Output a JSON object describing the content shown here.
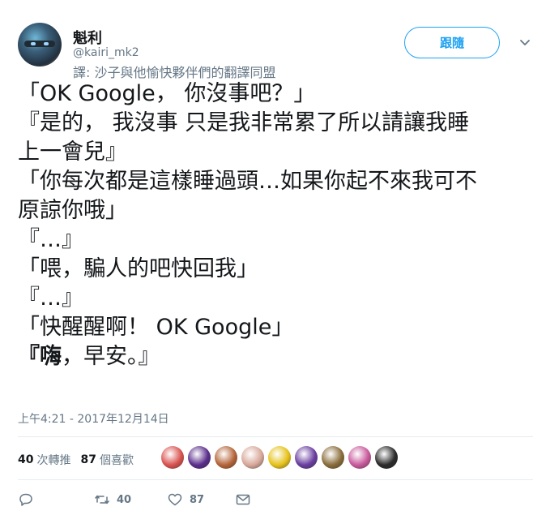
{
  "user": {
    "name": "魁利",
    "handle": "@kairi_mk2",
    "translation_note": "譯: 沙子與他愉快夥伴們的翻譯同盟"
  },
  "follow_button": {
    "label": "跟隨"
  },
  "tweet": {
    "lines": [
      "「OK Google， 你沒事吧？」",
      "『是的， 我沒事 只是我非常累了所以請讓我睡",
      "上一會兒』",
      "「你每次都是這樣睡過頭…如果你起不來我可不",
      "原諒你哦」",
      "『…』",
      "「喂，騙人的吧快回我」",
      "『…』",
      "「快醒醒啊！ OK Google」"
    ],
    "last_line_bold": "『嗨",
    "last_line_rest": "，早安。』",
    "timestamp": "上午4:21 - 2017年12月14日"
  },
  "stats": {
    "retweets_count": "40",
    "retweets_label": "次轉推",
    "likes_count": "87",
    "likes_label": "個喜歡"
  },
  "likers": [
    {
      "name": "liker-1",
      "color": "#d9534f"
    },
    {
      "name": "liker-2",
      "color": "#5b2e8c"
    },
    {
      "name": "liker-3",
      "color": "#b5653a"
    },
    {
      "name": "liker-4",
      "color": "#d8a89a"
    },
    {
      "name": "liker-5",
      "color": "#e6c21a"
    },
    {
      "name": "liker-6",
      "color": "#6a3fa0"
    },
    {
      "name": "liker-7",
      "color": "#8a6d3b"
    },
    {
      "name": "liker-8",
      "color": "#c85a9c"
    },
    {
      "name": "liker-9",
      "color": "#2b2b2b"
    }
  ],
  "actions": {
    "reply_count": "",
    "retweet_count": "40",
    "like_count": "87"
  },
  "colors": {
    "accent": "#1da1f2",
    "text": "#14171a",
    "muted": "#657786",
    "divider": "#e6ecf0"
  }
}
